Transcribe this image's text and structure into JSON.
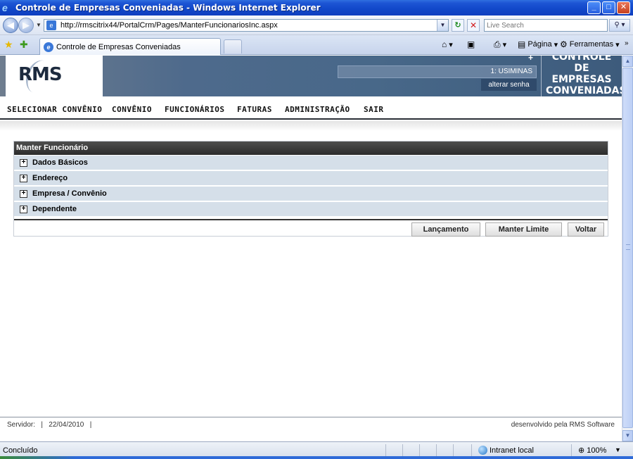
{
  "window": {
    "title": "Controle de Empresas Conveniadas - Windows Internet Explorer",
    "minimize": "_",
    "maximize": "□",
    "close": "✕"
  },
  "address": {
    "url": "http://rmscitrix44/PortalCrm/Pages/ManterFuncionariosInc.aspx",
    "search_placeholder": "Live Search"
  },
  "tab": {
    "label": "Controle de Empresas Conveniadas"
  },
  "commands": {
    "pagina": "Página",
    "ferramentas": "Ferramentas"
  },
  "header": {
    "logo": "RMS",
    "user": "1: USIMINAS",
    "change_password": "alterar senha",
    "brand_line1": "CONTROLE",
    "brand_line2": "DE EMPRESAS",
    "brand_line3": "CONVENIADAS"
  },
  "menu": [
    "SELECIONAR CONVÊNIO",
    "CONVÊNIO",
    "FUNCIONÁRIOS",
    "FATURAS",
    "ADMINISTRAÇÃO",
    "SAIR"
  ],
  "panel": {
    "title": "Manter Funcionário",
    "sections": [
      "Dados Básicos",
      "Endereço",
      "Empresa / Convênio",
      "Dependente"
    ],
    "buttons": {
      "lancamento": "Lançamento",
      "manter_limite": "Manter Limite",
      "voltar": "Voltar"
    }
  },
  "footer": {
    "servidor_label": "Servidor:",
    "date": "22/04/2010",
    "credit": "desenvolvido pela RMS Software"
  },
  "status": {
    "text": "Concluído",
    "zone": "Intranet local",
    "zoom": "100%"
  }
}
